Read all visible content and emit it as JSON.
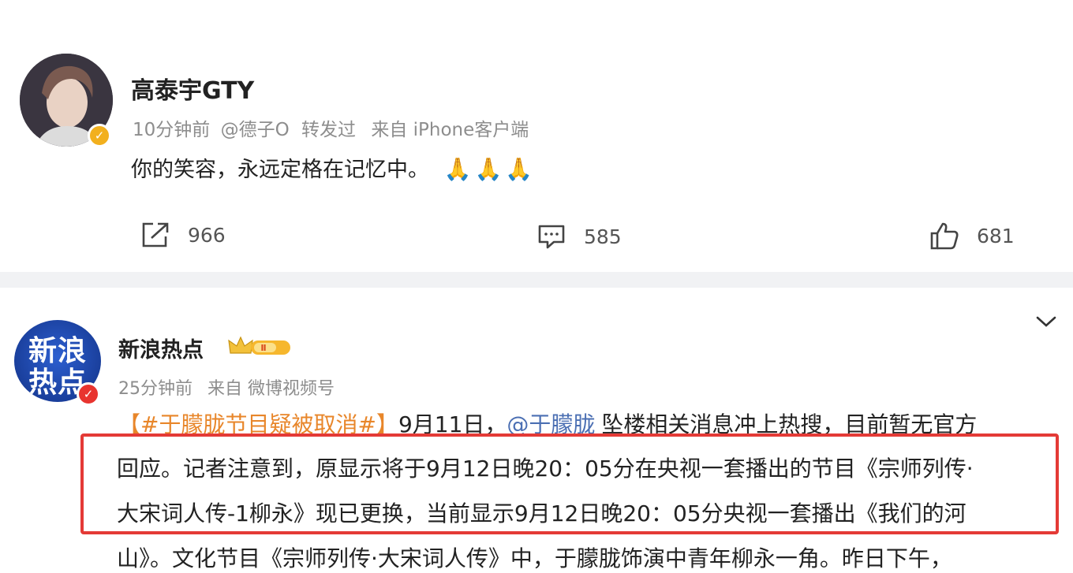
{
  "post1": {
    "username": "高泰宇GTY",
    "time": "10分钟前",
    "repost_from": "@德子O",
    "repost_label": "转发过",
    "source": "来自 iPhone客户端",
    "content": "你的笑容，永远定格在记忆中。",
    "emoji_icon": "pray-emoji",
    "actions": {
      "repost_count": "966",
      "comment_count": "585",
      "like_count": "681"
    }
  },
  "post2": {
    "avatar_line1": "新浪",
    "avatar_line2": "热点",
    "username": "新浪热点",
    "time": "25分钟前",
    "source": "来自 微博视频号",
    "badge_level": "Ⅱ",
    "lines": {
      "l1_hashtag": "【#于朦胧节目疑被取消#】",
      "l1_date": "9月11日，",
      "l1_mention": "@于朦胧",
      "l1_rest": "坠楼相关消息冲上热搜，目前暂无官方",
      "l2": "回应。记者注意到，原显示将于9月12日晚20：05分在央视一套播出的节目《宗师列传·",
      "l3": "大宋词人传-1柳永》现已更换，当前显示9月12日晚20：05分央视一套播出《我们的河",
      "l4": "山》。文化节目《宗师列传·大宋词人传》中，于朦胧饰演中青年柳永一角。昨日下午，"
    }
  },
  "colors": {
    "link_orange": "#e8862a",
    "mention_blue": "#4b6fb3",
    "highlight_red": "#e43a36",
    "verify_gold": "#f2b01e",
    "verify_red": "#e8342f"
  }
}
